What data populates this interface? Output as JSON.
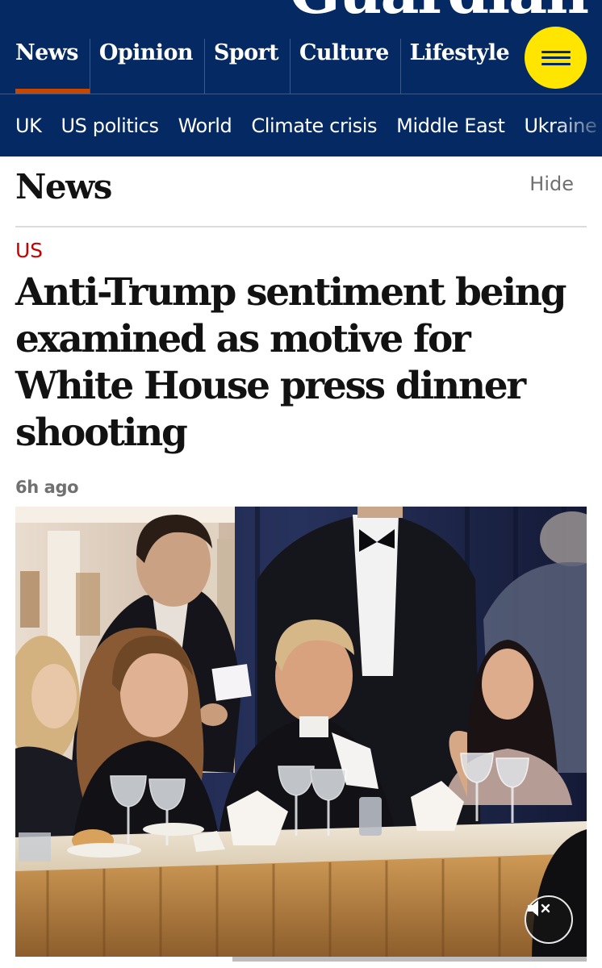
{
  "masthead": {
    "logo_text": "Guardian",
    "brand_color": "#052962",
    "pillars": [
      {
        "label": "News",
        "active": true
      },
      {
        "label": "Opinion",
        "active": false
      },
      {
        "label": "Sport",
        "active": false
      },
      {
        "label": "Culture",
        "active": false
      },
      {
        "label": "Lifestyle",
        "active": false
      }
    ],
    "active_accent_color": "#c74600",
    "menu_button_color": "#ffe500",
    "menu_icon": "hamburger-icon"
  },
  "subnav": {
    "items": [
      "UK",
      "US politics",
      "World",
      "Climate crisis",
      "Middle East",
      "Ukraine"
    ]
  },
  "section": {
    "title": "News",
    "hide_label": "Hide"
  },
  "article": {
    "kicker": "US",
    "kicker_color": "#c70000",
    "headline": "Anti-Trump sentiment being examined as motive for White House press dinner shooting",
    "timestamp": "6h ago"
  },
  "video": {
    "mute_icon": "speaker-muted-icon",
    "progress": 0.38
  }
}
